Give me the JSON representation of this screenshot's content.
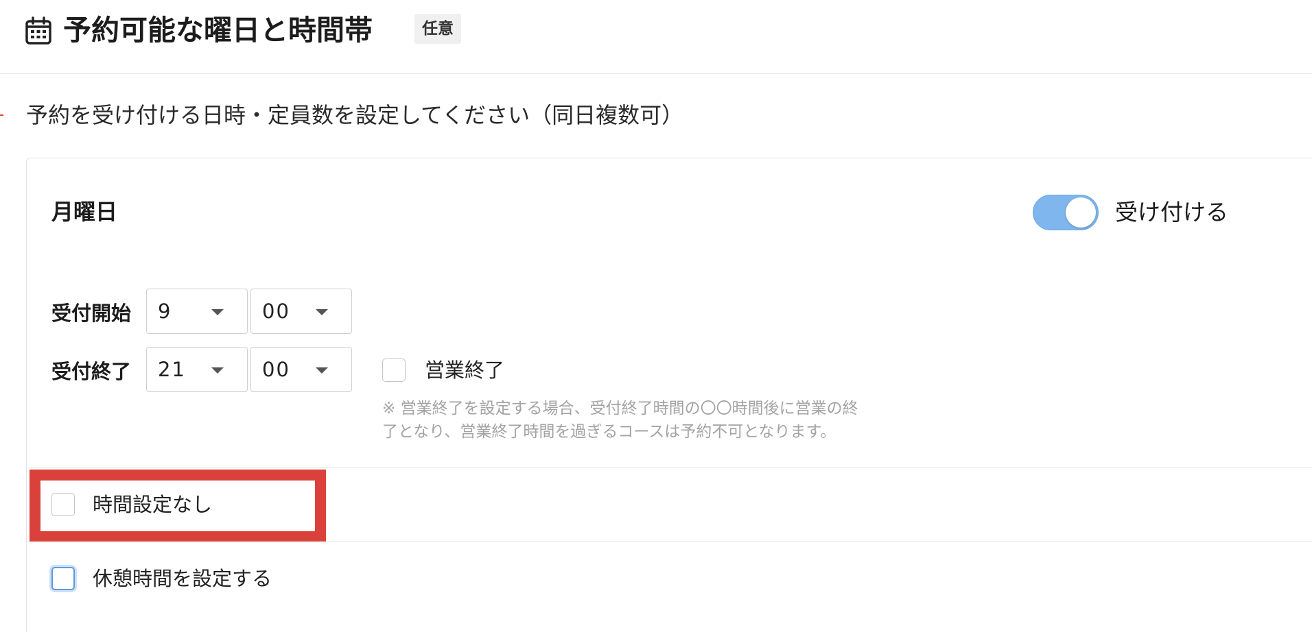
{
  "header": {
    "title": "予約可能な曜日と時間帯",
    "badge": "任意",
    "icon": "calendar-icon"
  },
  "description": "予約を受け付ける日時・定員数を設定してください（同日複数可）",
  "schedule": {
    "day": "月曜日",
    "accept_toggle": {
      "label": "受け付ける",
      "on": true,
      "color": "#7fb6ee"
    },
    "start": {
      "label": "受付開始",
      "hour": "9",
      "minute": "00"
    },
    "end": {
      "label": "受付終了",
      "hour": "21",
      "minute": "00"
    },
    "business_end": {
      "label": "営業終了",
      "checked": false,
      "note_line1": "※ 営業終了を設定する場合、受付終了時間の〇〇時間後に営業の終",
      "note_line2": "了となり、営業終了時間を過ぎるコースは予約不可となります。"
    },
    "no_time_setting": {
      "label": "時間設定なし",
      "checked": false,
      "highlight_color": "#d9413a"
    },
    "break_time": {
      "label": "休憩時間を設定する",
      "checked": false
    }
  }
}
